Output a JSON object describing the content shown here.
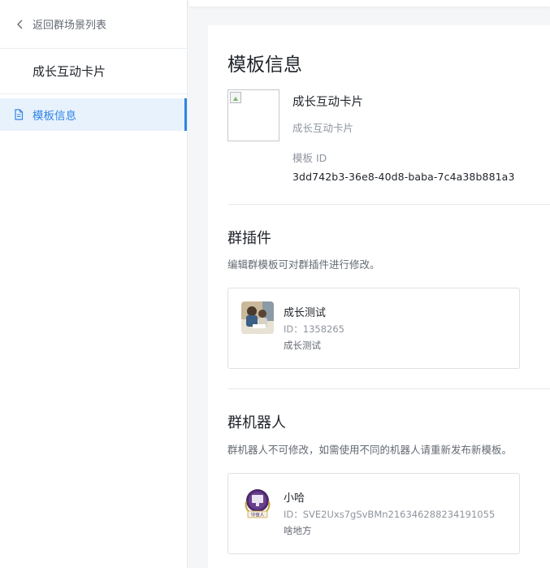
{
  "sidebar": {
    "back_label": "返回群场景列表",
    "template_name": "成长互动卡片",
    "nav_items": [
      {
        "label": "模板信息",
        "icon": "document-icon",
        "active": true
      }
    ]
  },
  "main": {
    "title": "模板信息",
    "template": {
      "name": "成长互动卡片",
      "description": "成长互动卡片",
      "id_label": "模板 ID",
      "id_value": "3dd742b3-36e8-40d8-baba-7c4a38b881a3"
    },
    "plugins": {
      "title": "群插件",
      "description": "编辑群模板可对群插件进行修改。",
      "items": [
        {
          "name": "成长测试",
          "id": "ID：1358265",
          "desc": "成长测试"
        }
      ]
    },
    "robots": {
      "title": "群机器人",
      "description": "群机器人不可修改，如需使用不同的机器人请重新发布新模板。",
      "items": [
        {
          "name": "小哈",
          "id": "ID：SVE2Uxs7gSvBMn216346288234191055",
          "desc": "啥地方",
          "badge_text": "守夜人"
        }
      ]
    }
  },
  "colors": {
    "accent": "#2f84e6",
    "active_bg": "#e8f2fd",
    "page_bg": "#f5f6f7",
    "border": "#dee0e3"
  }
}
